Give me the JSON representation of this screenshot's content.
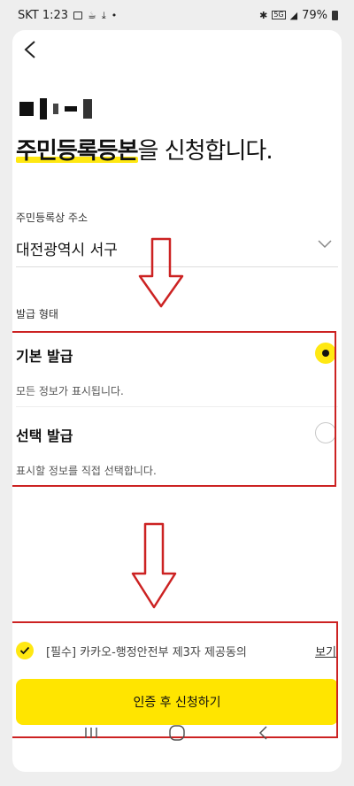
{
  "status_bar": {
    "carrier_time": "SKT 1:23",
    "battery": "79%",
    "network_badge": "5G",
    "dot": "•",
    "icons": [
      "image-icon",
      "coffee-icon",
      "download-icon",
      "bluetooth-icon",
      "signal-icon",
      "battery-icon"
    ]
  },
  "header": {
    "back_icon": "chevron-left-icon"
  },
  "title": {
    "highlight": "주민등록등본",
    "rest": "을 신청합니다."
  },
  "address": {
    "label": "주민등록상 주소",
    "value": "대전광역시 서구",
    "chevron_icon": "chevron-down-icon"
  },
  "issuance": {
    "label": "발급 형태",
    "options": [
      {
        "title": "기본 발급",
        "desc": "모든 정보가 표시됩니다.",
        "selected": true
      },
      {
        "title": "선택 발급",
        "desc": "표시할 정보를 직접 선택합니다.",
        "selected": false
      }
    ]
  },
  "consent": {
    "text": "[필수] 카카오-행정안전부 제3자 제공동의",
    "view_label": "보기",
    "checked": true
  },
  "submit": {
    "label": "인증 후 신청하기"
  },
  "colors": {
    "accent": "#ffe812",
    "annotation": "#cc2222"
  },
  "nav": {
    "icons": [
      "recent-apps-icon",
      "home-icon",
      "back-icon"
    ]
  }
}
